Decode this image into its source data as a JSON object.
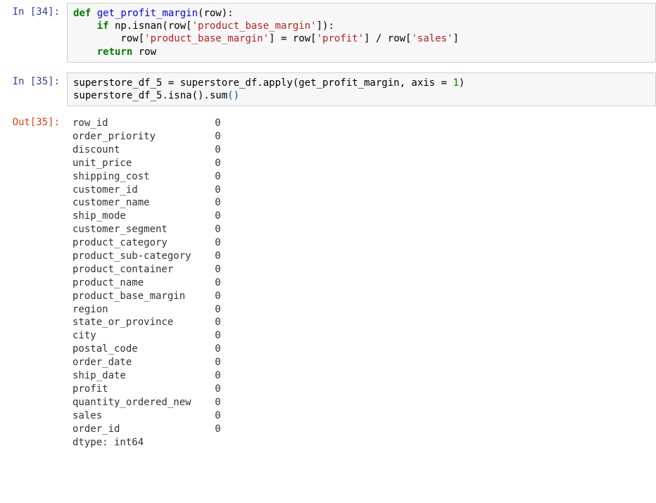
{
  "cells": {
    "c34": {
      "prompt": "In [34]:",
      "tokens": [
        {
          "t": "def ",
          "c": "kw"
        },
        {
          "t": "get_profit_margin",
          "c": "fn"
        },
        {
          "t": "(row):",
          "c": ""
        },
        {
          "t": "\n",
          "c": ""
        },
        {
          "t": "    ",
          "c": ""
        },
        {
          "t": "if",
          "c": "kw"
        },
        {
          "t": " np.isnan(row[",
          "c": ""
        },
        {
          "t": "'product_base_margin'",
          "c": "str"
        },
        {
          "t": "]):",
          "c": ""
        },
        {
          "t": "\n",
          "c": ""
        },
        {
          "t": "        row[",
          "c": ""
        },
        {
          "t": "'product_base_margin'",
          "c": "str"
        },
        {
          "t": "] = row[",
          "c": ""
        },
        {
          "t": "'profit'",
          "c": "str"
        },
        {
          "t": "] / row[",
          "c": ""
        },
        {
          "t": "'sales'",
          "c": "str"
        },
        {
          "t": "]",
          "c": ""
        },
        {
          "t": "\n",
          "c": ""
        },
        {
          "t": "    ",
          "c": ""
        },
        {
          "t": "return",
          "c": "kw"
        },
        {
          "t": " row",
          "c": ""
        }
      ]
    },
    "c35": {
      "prompt": "In [35]:",
      "tokens": [
        {
          "t": "superstore_df_5 = superstore_df.apply(get_profit_margin, axis = ",
          "c": ""
        },
        {
          "t": "1",
          "c": "num"
        },
        {
          "t": ")",
          "c": ""
        },
        {
          "t": "\n",
          "c": ""
        },
        {
          "t": "superstore_df_5.isna().sum",
          "c": ""
        },
        {
          "t": "()",
          "c": "paren-active"
        }
      ]
    },
    "o35": {
      "prompt": "Out[35]:",
      "rows": [
        {
          "name": "row_id",
          "val": "0"
        },
        {
          "name": "order_priority",
          "val": "0"
        },
        {
          "name": "discount",
          "val": "0"
        },
        {
          "name": "unit_price",
          "val": "0"
        },
        {
          "name": "shipping_cost",
          "val": "0"
        },
        {
          "name": "customer_id",
          "val": "0"
        },
        {
          "name": "customer_name",
          "val": "0"
        },
        {
          "name": "ship_mode",
          "val": "0"
        },
        {
          "name": "customer_segment",
          "val": "0"
        },
        {
          "name": "product_category",
          "val": "0"
        },
        {
          "name": "product_sub-category",
          "val": "0"
        },
        {
          "name": "product_container",
          "val": "0"
        },
        {
          "name": "product_name",
          "val": "0"
        },
        {
          "name": "product_base_margin",
          "val": "0"
        },
        {
          "name": "region",
          "val": "0"
        },
        {
          "name": "state_or_province",
          "val": "0"
        },
        {
          "name": "city",
          "val": "0"
        },
        {
          "name": "postal_code",
          "val": "0"
        },
        {
          "name": "order_date",
          "val": "0"
        },
        {
          "name": "ship_date",
          "val": "0"
        },
        {
          "name": "profit",
          "val": "0"
        },
        {
          "name": "quantity_ordered_new",
          "val": "0"
        },
        {
          "name": "sales",
          "val": "0"
        },
        {
          "name": "order_id",
          "val": "0"
        }
      ],
      "dtype": "dtype: int64"
    }
  }
}
